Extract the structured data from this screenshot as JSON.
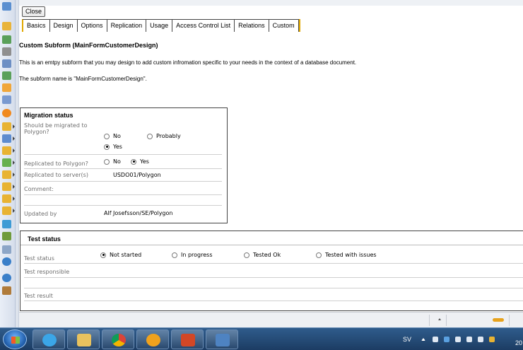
{
  "toolbar": {
    "close_label": "Close"
  },
  "tabs": [
    {
      "label": "Basics"
    },
    {
      "label": "Design"
    },
    {
      "label": "Options"
    },
    {
      "label": "Replication"
    },
    {
      "label": "Usage"
    },
    {
      "label": "Access Control List"
    },
    {
      "label": "Relations"
    },
    {
      "label": "Custom",
      "active": true
    }
  ],
  "content": {
    "heading": "Custom Subform (MainFormCustomerDesign)",
    "description": "This is an emtpy subform that you may design to add custom infromation specific to your needs in the context of a database document.",
    "subform_name_text": "The subform name is \"MainFormCustomerDesign\"."
  },
  "migration": {
    "title": "Migration status",
    "should_migrate_label": "Should be migrated to Polygon?",
    "should_migrate_options": [
      "No",
      "Probably",
      "Yes"
    ],
    "should_migrate_selected": "Yes",
    "replicated_label": "Replicated to Polygon?",
    "replicated_options": [
      "No",
      "Yes"
    ],
    "replicated_selected": "Yes",
    "servers_label": "Replicated to server(s)",
    "servers_value": "USDO01/Polygon",
    "comment_label": "Comment:",
    "comment_value": "",
    "updated_by_label": "Updated by",
    "updated_by_value": "Alf Josefsson/SE/Polygon"
  },
  "test": {
    "title": "Test status",
    "status_label": "Test status",
    "status_options": [
      "Not started",
      "In progress",
      "Tested Ok",
      "Tested with issues"
    ],
    "status_selected": "Not started",
    "responsible_label": "Test responsible",
    "result_label": "Test result"
  },
  "taskbar": {
    "language": "SV",
    "clock_fragment": "20"
  },
  "colors": {
    "tab_accent": "#e1a800",
    "taskbar": "#1f436d"
  }
}
